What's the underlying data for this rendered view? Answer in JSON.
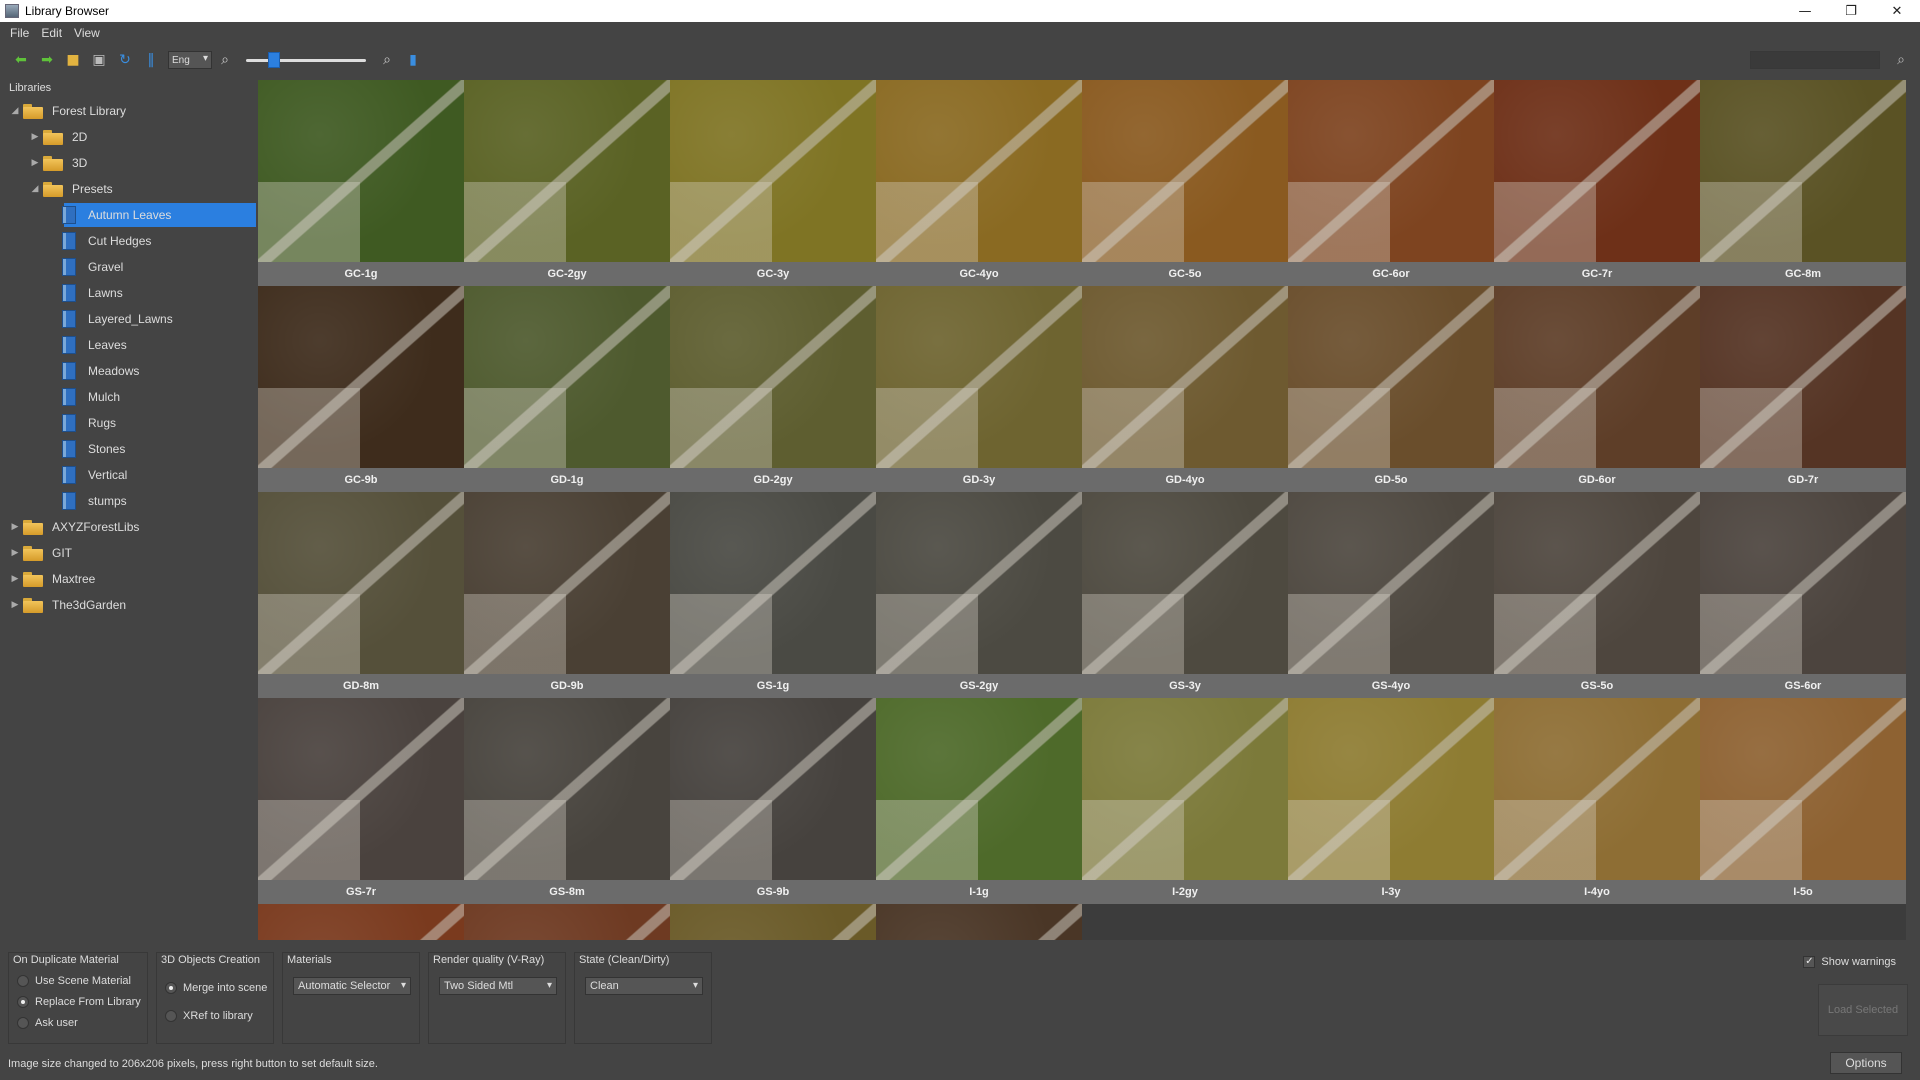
{
  "window": {
    "title": "Library Browser",
    "minimize_glyph": "—",
    "maximize_glyph": "❐",
    "close_glyph": "✕"
  },
  "menu": [
    "File",
    "Edit",
    "View"
  ],
  "toolbar": {
    "language_value": "Eng",
    "zoom_slider_fraction": 0.2,
    "icons": [
      "back-arrow-icon",
      "forward-arrow-icon",
      "open-folder-icon",
      "save-icon",
      "refresh-icon",
      "filter-icon",
      "zoom-out-icon",
      "zoom-in-icon",
      "info-icon",
      "search-icon"
    ]
  },
  "libraries": {
    "header": "Libraries",
    "tree": [
      {
        "label": "Forest Library",
        "level": 0,
        "type": "folder",
        "expanded": true
      },
      {
        "label": "2D",
        "level": 1,
        "type": "folder",
        "expanded": false
      },
      {
        "label": "3D",
        "level": 1,
        "type": "folder",
        "expanded": false
      },
      {
        "label": "Presets",
        "level": 1,
        "type": "folder",
        "expanded": true
      },
      {
        "label": "Autumn Leaves",
        "level": 2,
        "type": "library",
        "selected": true
      },
      {
        "label": "Cut Hedges",
        "level": 2,
        "type": "library"
      },
      {
        "label": "Gravel",
        "level": 2,
        "type": "library"
      },
      {
        "label": "Lawns",
        "level": 2,
        "type": "library"
      },
      {
        "label": "Layered_Lawns",
        "level": 2,
        "type": "library"
      },
      {
        "label": "Leaves",
        "level": 2,
        "type": "library"
      },
      {
        "label": "Meadows",
        "level": 2,
        "type": "library"
      },
      {
        "label": "Mulch",
        "level": 2,
        "type": "library"
      },
      {
        "label": "Rugs",
        "level": 2,
        "type": "library"
      },
      {
        "label": "Stones",
        "level": 2,
        "type": "library"
      },
      {
        "label": "Vertical",
        "level": 2,
        "type": "library"
      },
      {
        "label": "stumps",
        "level": 2,
        "type": "library"
      },
      {
        "label": "AXYZForestLibs",
        "level": 0,
        "type": "folder",
        "expanded": false
      },
      {
        "label": "GIT",
        "level": 0,
        "type": "folder",
        "expanded": false
      },
      {
        "label": "Maxtree",
        "level": 0,
        "type": "folder",
        "expanded": false
      },
      {
        "label": "The3dGarden",
        "level": 0,
        "type": "folder",
        "expanded": false
      }
    ]
  },
  "thumbnails": [
    {
      "label": "GC-1g",
      "color": "#3f5a22"
    },
    {
      "label": "GC-2gy",
      "color": "#5a6224"
    },
    {
      "label": "GC-3y",
      "color": "#7f7424"
    },
    {
      "label": "GC-4yo",
      "color": "#8a6a22"
    },
    {
      "label": "GC-5o",
      "color": "#8a5a20"
    },
    {
      "label": "GC-6or",
      "color": "#7e4420"
    },
    {
      "label": "GC-7r",
      "color": "#6e3018"
    },
    {
      "label": "GC-8m",
      "color": "#5a5224"
    },
    {
      "label": "GC-9b",
      "color": "#3e2c1c"
    },
    {
      "label": "GD-1g",
      "color": "#4e5a2e"
    },
    {
      "label": "GD-2gy",
      "color": "#5e5e30"
    },
    {
      "label": "GD-3y",
      "color": "#6e6430"
    },
    {
      "label": "GD-4yo",
      "color": "#6e5a30"
    },
    {
      "label": "GD-5o",
      "color": "#6a4e2c"
    },
    {
      "label": "GD-6or",
      "color": "#5e3e28"
    },
    {
      "label": "GD-7r",
      "color": "#553424"
    },
    {
      "label": "GD-8m",
      "color": "#55503a"
    },
    {
      "label": "GD-9b",
      "color": "#4a4034"
    },
    {
      "label": "GS-1g",
      "color": "#4a4a44"
    },
    {
      "label": "GS-2gy",
      "color": "#4c4a42"
    },
    {
      "label": "GS-3y",
      "color": "#4e4a40"
    },
    {
      "label": "GS-4yo",
      "color": "#4e4840"
    },
    {
      "label": "GS-5o",
      "color": "#4e463e"
    },
    {
      "label": "GS-6or",
      "color": "#4c443e"
    },
    {
      "label": "GS-7r",
      "color": "#4a423e"
    },
    {
      "label": "GS-8m",
      "color": "#48443e"
    },
    {
      "label": "GS-9b",
      "color": "#46423e"
    },
    {
      "label": "I-1g",
      "color": "#4e6a2a"
    },
    {
      "label": "I-2gy",
      "color": "#7c7a3a"
    },
    {
      "label": "I-3y",
      "color": "#8e7c32"
    },
    {
      "label": "I-4yo",
      "color": "#8e6e34"
    },
    {
      "label": "I-5o",
      "color": "#8e6232"
    },
    {
      "label": "",
      "color": "#7a3a1e"
    },
    {
      "label": "",
      "color": "#6e3a22"
    },
    {
      "label": "",
      "color": "#6a5a28"
    },
    {
      "label": "",
      "color": "#4a3626"
    }
  ],
  "options": {
    "on_duplicate": {
      "title": "On Duplicate Material",
      "items": [
        "Use Scene Material",
        "Replace From Library",
        "Ask user"
      ],
      "selected": 1
    },
    "objects_creation": {
      "title": "3D Objects Creation",
      "items": [
        "Merge into scene",
        "XRef to library"
      ],
      "selected": 0
    },
    "materials": {
      "title": "Materials",
      "value": "Automatic Selector"
    },
    "render_quality": {
      "title": "Render quality (V-Ray)",
      "value": "Two Sided Mtl"
    },
    "state": {
      "title": "State (Clean/Dirty)",
      "value": "Clean"
    },
    "show_warnings": {
      "label": "Show warnings",
      "checked": true
    },
    "load_selected": "Load Selected",
    "options_button": "Options"
  },
  "status": "Image size changed to 206x206 pixels, press right button to set default size."
}
